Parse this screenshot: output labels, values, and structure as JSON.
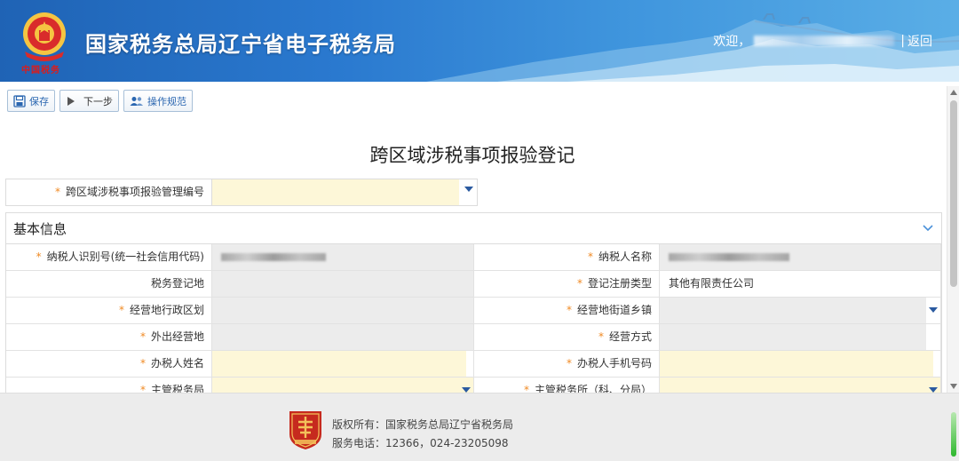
{
  "header": {
    "emblem_text": "中国税务",
    "title": "国家税务总局辽宁省电子税务局",
    "welcome": "欢迎，",
    "separator": "|",
    "back_label": "返回"
  },
  "toolbar": {
    "save_label": "保存",
    "next_label": "下一步",
    "guide_label": "操作规范"
  },
  "page": {
    "title": "跨区域涉税事项报验登记"
  },
  "mgmt": {
    "label": "跨区域涉税事项报验管理编号"
  },
  "basic_info": {
    "title": "基本信息",
    "rows": [
      {
        "left_label": "纳税人识别号(统一社会信用代码)",
        "left_required": true,
        "left_value": "",
        "right_label": "纳税人名称",
        "right_required": true,
        "right_value": ""
      },
      {
        "left_label": "税务登记地",
        "left_required": false,
        "left_value": "",
        "right_label": "登记注册类型",
        "right_required": true,
        "right_value": "其他有限责任公司"
      },
      {
        "left_label": "经营地行政区划",
        "left_required": true,
        "left_value": "",
        "right_label": "经营地街道乡镇",
        "right_required": true,
        "right_value": ""
      },
      {
        "left_label": "外出经营地",
        "left_required": true,
        "left_value": "",
        "right_label": "经营方式",
        "right_required": true,
        "right_value": ""
      },
      {
        "left_label": "办税人姓名",
        "left_required": true,
        "left_value": "",
        "right_label": "办税人手机号码",
        "right_required": true,
        "right_value": ""
      },
      {
        "left_label": "主管税务局",
        "left_required": true,
        "left_value": "",
        "right_label": "主管税务所（科、分局）",
        "right_required": true,
        "right_value": ""
      }
    ]
  },
  "footer": {
    "copyright": "版权所有：国家税务总局辽宁省税务局",
    "hotline": "服务电话：12366，024-23205098"
  },
  "colors": {
    "header_blue": "#2a79cf",
    "required_orange": "#f08a24",
    "input_yellow": "#fdf7d8",
    "readonly_gray": "#ececec",
    "link_blue": "#2a66b0"
  }
}
